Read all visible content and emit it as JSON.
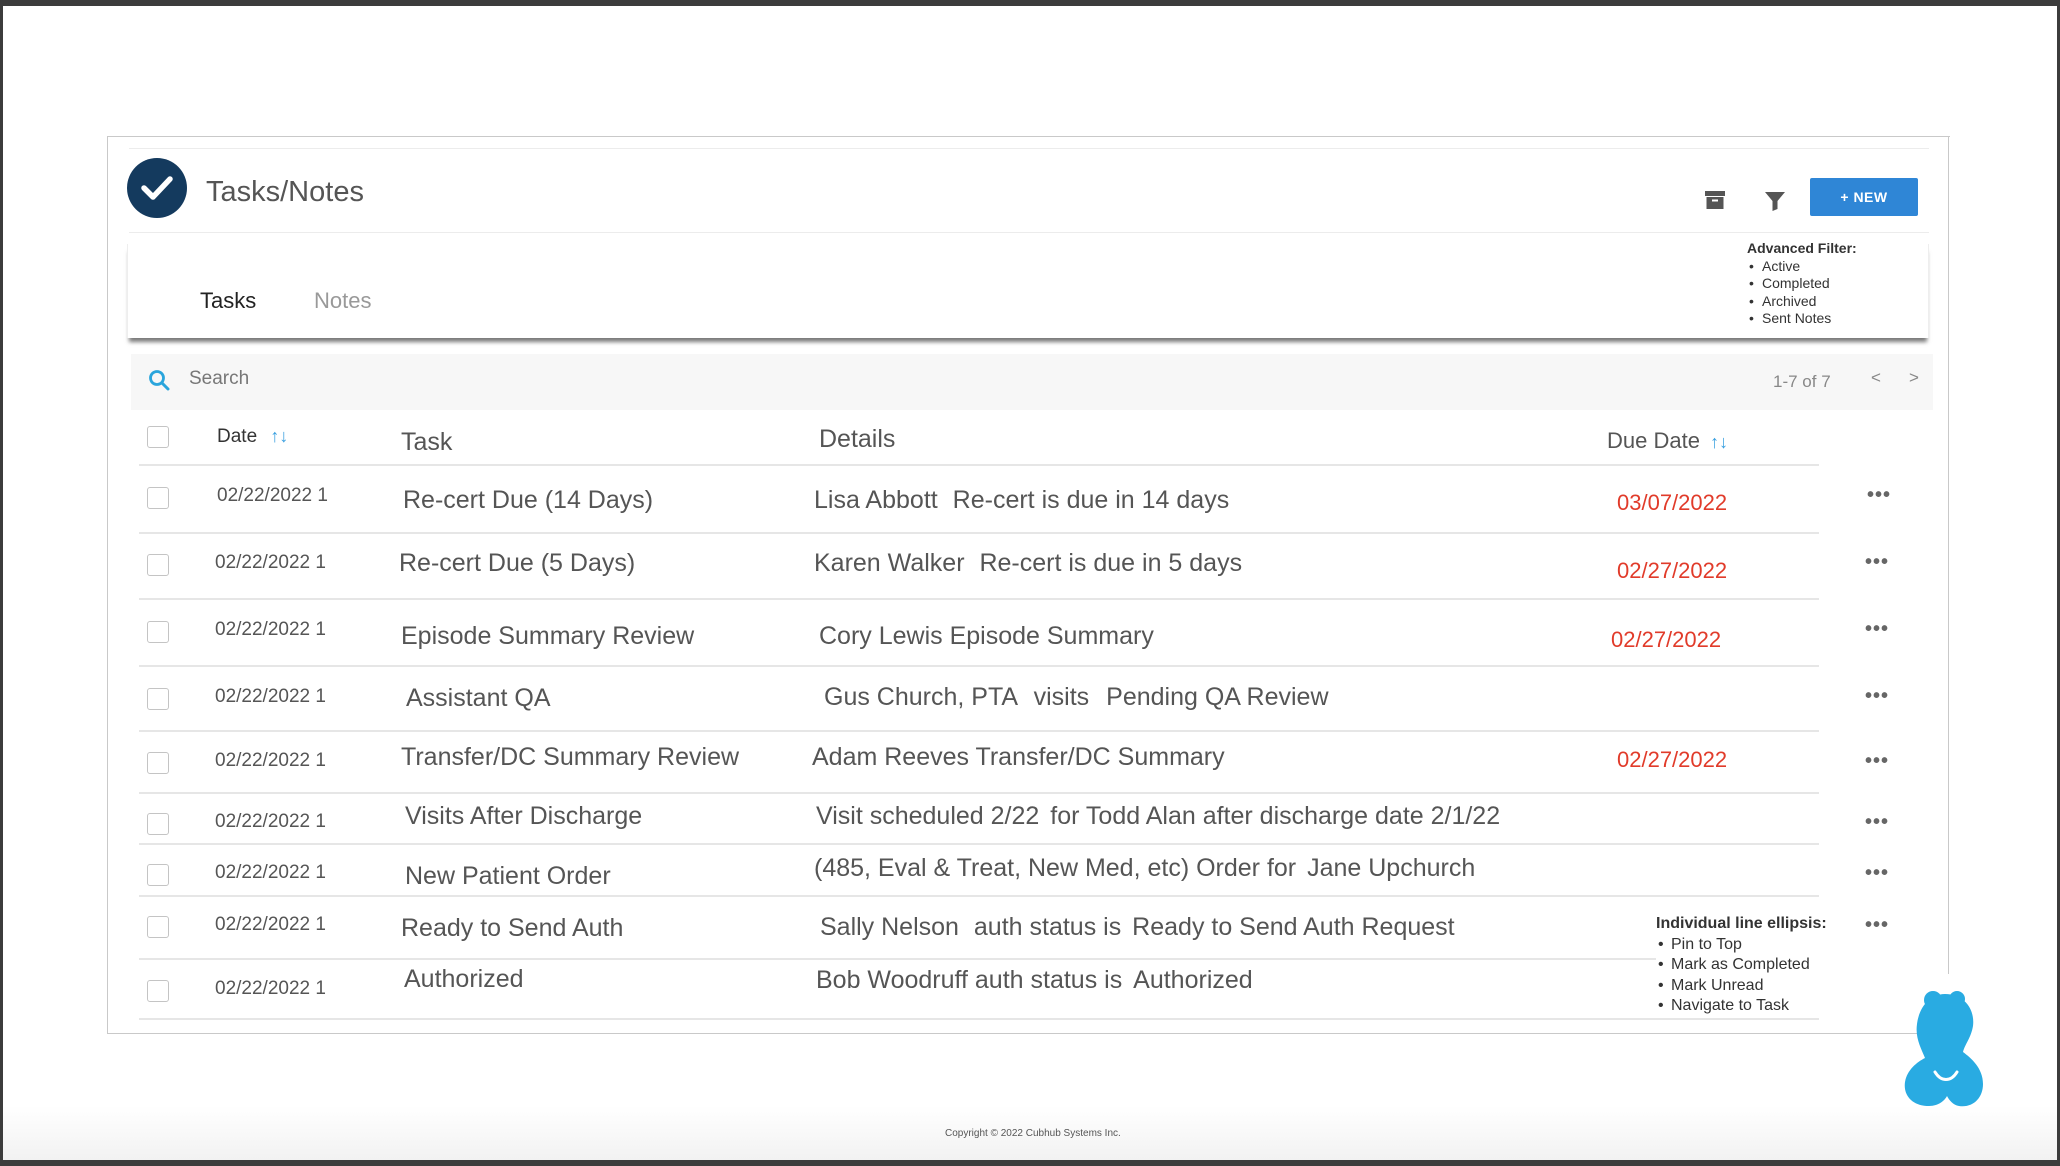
{
  "header": {
    "title": "Tasks/Notes",
    "new_button": "+ NEW",
    "icons": [
      "archive-icon",
      "filter-icon"
    ]
  },
  "tabs": [
    {
      "label": "Tasks",
      "active": true
    },
    {
      "label": "Notes",
      "active": false
    }
  ],
  "advanced_filter": {
    "title": "Advanced Filter:",
    "items": [
      "Active",
      "Completed",
      "Archived",
      "Sent Notes"
    ]
  },
  "search": {
    "placeholder": "Search",
    "pager": "1-7 of 7",
    "prev": "<",
    "next": ">"
  },
  "columns": {
    "date": "Date",
    "task": "Task",
    "details": "Details",
    "due_date": "Due Date",
    "sort_glyph": "↑↓"
  },
  "rows": [
    {
      "date": "02/22/2022 1",
      "task": "Re-cert Due (14 Days)",
      "details_a": "Lisa Abbott",
      "details_b": "Re-cert is due in 14 days",
      "due": "03/07/2022"
    },
    {
      "date": "02/22/2022 1",
      "task": "Re-cert Due (5 Days)",
      "details_a": "Karen Walker",
      "details_b": "Re-cert is due in 5 days",
      "due": "02/27/2022"
    },
    {
      "date": "02/22/2022 1",
      "task": "Episode Summary Review",
      "details_a": "Cory Lewis Episode Summary",
      "details_b": "",
      "due": "02/27/2022"
    },
    {
      "date": "02/22/2022 1",
      "task": "Assistant QA",
      "details_a": "Gus Church, PTA",
      "details_b": "visits",
      "details_c": "Pending QA Review",
      "due": ""
    },
    {
      "date": "02/22/2022 1",
      "task": "Transfer/DC Summary Review",
      "details_a": "Adam Reeves Transfer/DC Summary",
      "details_b": "",
      "due": "02/27/2022"
    },
    {
      "date": "02/22/2022 1",
      "task": "Visits After Discharge",
      "details_a": "Visit scheduled 2/22",
      "details_b": "for Todd Alan after discharge date 2/1/22",
      "due": ""
    },
    {
      "date": "02/22/2022 1",
      "task": "New Patient Order",
      "details_a": "(485, Eval & Treat, New Med, etc) Order for",
      "details_b": "Jane Upchurch",
      "due": ""
    },
    {
      "date": "02/22/2022 1",
      "task": "Ready to Send Auth",
      "details_a": "Sally Nelson",
      "details_b": "auth status is",
      "details_c": "Ready to Send Auth Request",
      "due": ""
    },
    {
      "date": "02/22/2022 1",
      "task": "Authorized",
      "details_a": "Bob Woodruff auth status is",
      "details_b": "Authorized",
      "due": ""
    }
  ],
  "row_menu_glyph": "•••",
  "line_ellipsis": {
    "title": "Individual line ellipsis:",
    "items": [
      "Pin to Top",
      "Mark as Completed",
      "Mark Unread",
      "Navigate to Task"
    ]
  },
  "footer": {
    "copyright": "Copyright © 2022 Cubhub Systems Inc."
  },
  "colors": {
    "brand_navy": "#143a5e",
    "accent_blue": "#2f86d6",
    "due_red": "#e13b2a",
    "bear_cyan": "#29abe2"
  }
}
